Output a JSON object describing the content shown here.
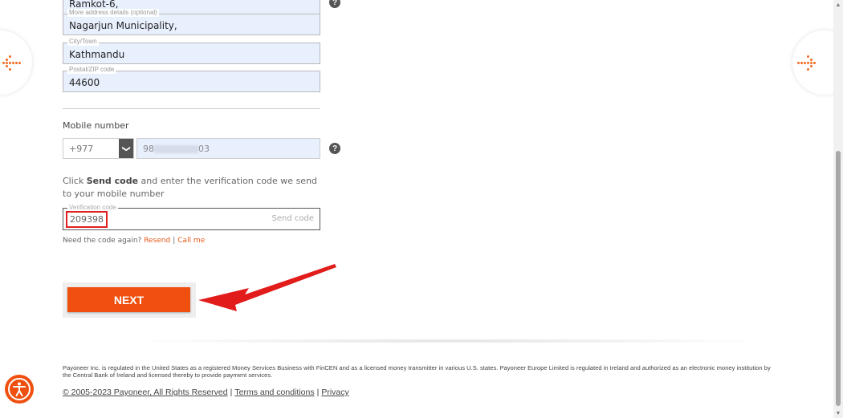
{
  "form": {
    "address_line1_value": "Ramkot-6,",
    "address_more_legend": "More address details (optional)",
    "address_more_value": "Nagarjun Municipality,",
    "city_legend": "City/Town",
    "city_value": "Kathmandu",
    "zip_legend": "Postal/ZIP code",
    "zip_value": "44600",
    "help_glyph": "?"
  },
  "mobile": {
    "label": "Mobile number",
    "country_code": "+977",
    "chevron_glyph": "❯",
    "phone_visible_prefix": "98",
    "phone_visible_suffix": "03"
  },
  "verification": {
    "instruction_prefix": "Click ",
    "instruction_bold": "Send code",
    "instruction_suffix": " and enter the verification code we send to your mobile number",
    "legend": "Verification code",
    "code_value": "209398",
    "send_code_label": "Send code",
    "need_again": "Need the code again?",
    "resend_label": "Resend",
    "separator": "|",
    "call_me_label": "Call me"
  },
  "actions": {
    "next_label": "NEXT"
  },
  "footer": {
    "legal_text": "Payoneer Inc. is regulated in the United States as a registered Money Services Business with FinCEN and as a licensed money transmitter in various U.S. states. Payoneer Europe Limited is regulated in Ireland and authorized as an electronic money institution by the Central Bank of Ireland and licensed thereby to provide payment services.",
    "copyright_link": "© 2005-2023 Payoneer, All Rights Reserved",
    "terms_link": "Terms and conditions",
    "privacy_link": "Privacy",
    "pipe": "|"
  },
  "icons": {
    "nav_left": "dotted-arrow-left-icon",
    "nav_right": "dotted-arrow-right-icon",
    "accessibility": "accessibility-icon",
    "annotation_arrow": "red-pointer-arrow-icon"
  },
  "colors": {
    "brand_orange": "#ef4f0f",
    "link_orange": "#e55a1a",
    "autofill_blue": "#e8f0fe",
    "annotation_red": "#e02020"
  },
  "scrollbar": {
    "up_glyph": "▲",
    "down_glyph": "▼"
  }
}
